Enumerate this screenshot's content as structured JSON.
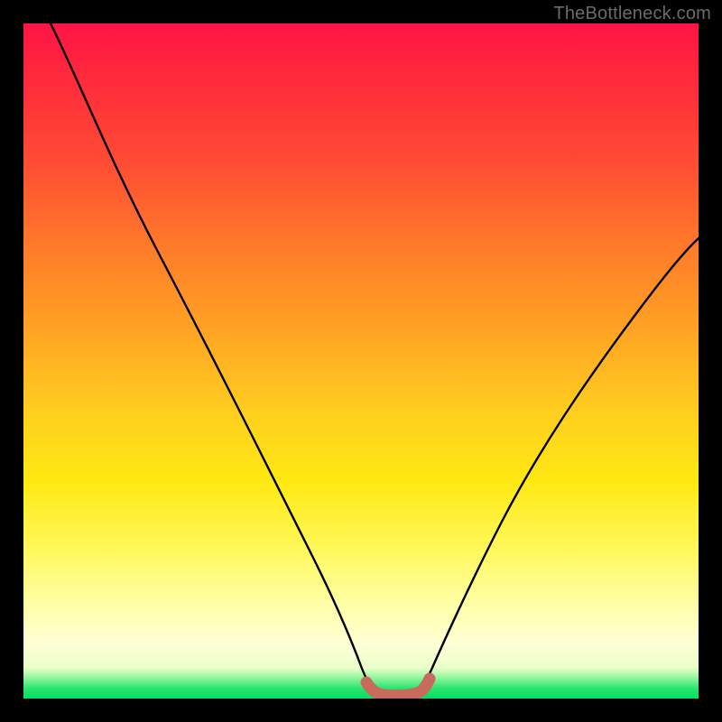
{
  "watermark": "TheBottleneck.com",
  "chart_data": {
    "type": "line",
    "title": "",
    "xlabel": "",
    "ylabel": "",
    "xlim": [
      0,
      100
    ],
    "ylim": [
      0,
      100
    ],
    "grid": false,
    "legend": false,
    "series": [
      {
        "name": "bottleneck-curve",
        "x": [
          4,
          10,
          16,
          22,
          28,
          34,
          40,
          46,
          49,
          51,
          54,
          57,
          59,
          62,
          66,
          72,
          78,
          84,
          90,
          96,
          100
        ],
        "values": [
          100,
          88,
          77,
          66,
          55,
          44,
          33,
          20,
          10,
          3,
          1,
          1,
          3,
          9,
          18,
          29,
          38,
          46,
          54,
          61,
          66
        ]
      }
    ],
    "highlight_band": {
      "name": "optimal-zone",
      "color": "#c96a5f",
      "x_start": 51,
      "x_end": 59,
      "y": 1
    },
    "gradient_stops": [
      {
        "pos": 0,
        "color": "#ff1446"
      },
      {
        "pos": 0.33,
        "color": "#ff7a2a"
      },
      {
        "pos": 0.68,
        "color": "#ffe912"
      },
      {
        "pos": 0.92,
        "color": "#ffffd6"
      },
      {
        "pos": 1.0,
        "color": "#04dd62"
      }
    ]
  }
}
